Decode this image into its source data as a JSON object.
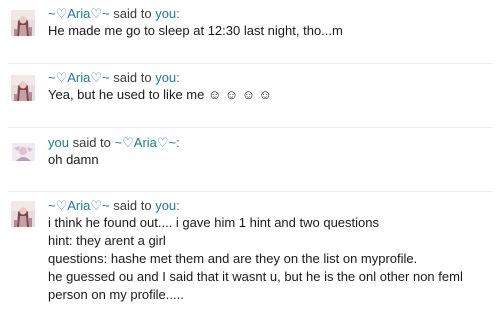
{
  "messages": [
    {
      "from": "~♡Aria♡~",
      "said_to": "said to",
      "to": "you:",
      "lines": [
        "He made me go to sleep at 12:30 last night, tho...m"
      ]
    },
    {
      "from": "~♡Aria♡~",
      "said_to": "said to",
      "to": "you:",
      "lines": [
        "Yea, but he used to like me ☺ ☺ ☺ ☺"
      ]
    },
    {
      "from": "you",
      "said_to": "said to",
      "to": "~♡Aria♡~:",
      "lines": [
        "oh damn"
      ]
    },
    {
      "from": "~♡Aria♡~",
      "said_to": "said to",
      "to": "you:",
      "lines": [
        "i think he found out.... i gave him 1 hint and two questions",
        "hint: they arent a girl",
        "questions: hashe met them and are they on the list on myprofile.",
        "he guessed ou and I said that it wasnt u, but he is the onl other non feml",
        "person on my profile....."
      ]
    }
  ],
  "colors": {
    "link": "#1d7f86",
    "divider": "#ececec"
  },
  "icons": {
    "aria_avatar": "aria-avatar-photo",
    "you_avatar": "you-avatar-photo"
  }
}
